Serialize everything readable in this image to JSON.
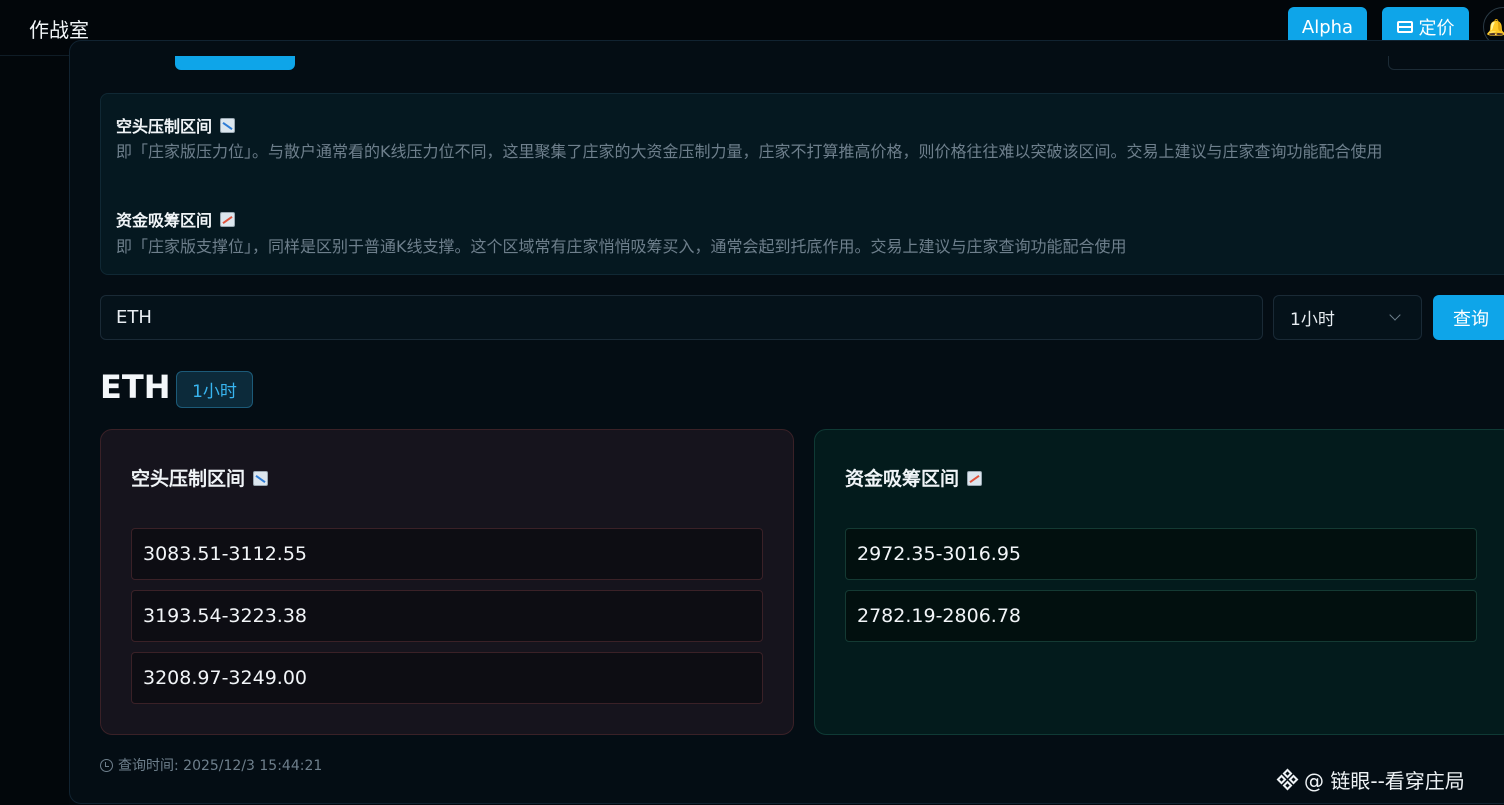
{
  "app": {
    "title": "作战室"
  },
  "header": {
    "alpha_label": "Alpha",
    "pricing_label": "定价"
  },
  "info": {
    "short_title": "空头压制区间",
    "short_desc": "即「庄家版压力位」。与散户通常看的K线压力位不同，这里聚集了庄家的大资金压制力量，庄家不打算推高价格，则价格往往难以突破该区间。交易上建议与庄家查询功能配合使用",
    "long_title": "资金吸筹区间",
    "long_desc": "即「庄家版支撑位」，同样是区别于普通K线支撑。这个区域常有庄家悄悄吸筹买入，通常会起到托底作用。交易上建议与庄家查询功能配合使用"
  },
  "search": {
    "value": "ETH",
    "interval": "1小时",
    "query_label": "查询"
  },
  "result": {
    "symbol": "ETH",
    "interval": "1小时",
    "short_zone": {
      "title": "空头压制区间",
      "ranges": [
        "3083.51-3112.55",
        "3193.54-3223.38",
        "3208.97-3249.00"
      ]
    },
    "long_zone": {
      "title": "资金吸筹区间",
      "ranges": [
        "2972.35-3016.95",
        "2782.19-2806.78"
      ]
    },
    "query_time": "查询时间: 2025/12/3 15:44:21"
  },
  "watermark": {
    "text": "@ 链眼--看穿庄局"
  },
  "colors": {
    "accent": "#0ea5e9",
    "short_border": "#3a2127",
    "long_border": "#0f3a35"
  }
}
